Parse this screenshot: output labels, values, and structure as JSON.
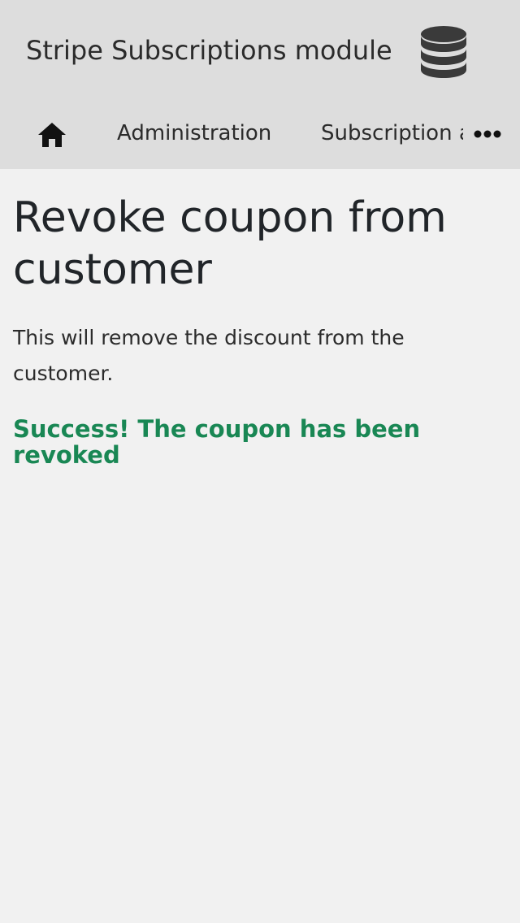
{
  "header": {
    "title": "Stripe Subscriptions module",
    "logo_icon": "database-icon"
  },
  "nav": {
    "home_icon": "home-icon",
    "items": [
      {
        "label": "Administration"
      },
      {
        "label": "Subscription and coupons"
      }
    ],
    "more_icon": "more-horizontal-icon"
  },
  "main": {
    "title": "Revoke coupon from customer",
    "description": "This will remove the discount from the customer.",
    "success_message": "Success! The coupon has been revoked"
  },
  "colors": {
    "header_bg": "#dddddd",
    "page_bg": "#f1f1f1",
    "success": "#198754",
    "text": "#212529"
  }
}
